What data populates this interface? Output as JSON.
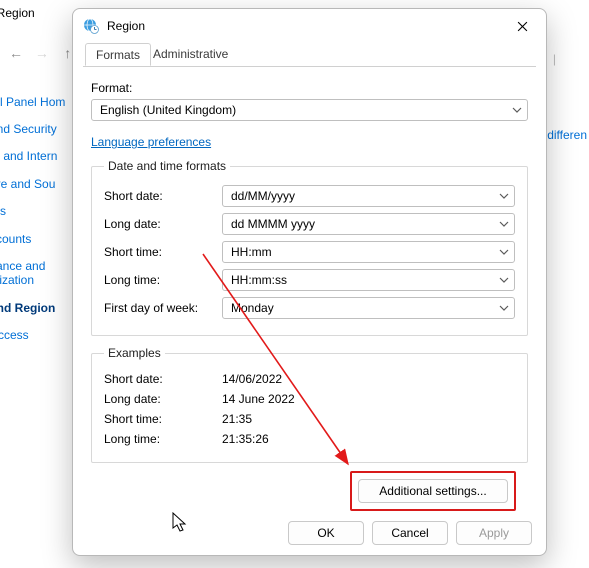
{
  "bg": {
    "breadcrumb_tail": "nd Region",
    "home_link": "l Panel Hom",
    "right_link": "differen",
    "sidebar": [
      "and Security",
      "rk and Intern",
      "are and Sou",
      "ms",
      "ccounts",
      "vance and\nalization",
      "and Region",
      "Access"
    ]
  },
  "dialog": {
    "title": "Region",
    "tabs": {
      "formats": "Formats",
      "administrative": "Administrative"
    },
    "format_label": "Format:",
    "format_value": "English (United Kingdom)",
    "lang_pref": "Language preferences",
    "group_datetime": "Date and time formats",
    "rows": {
      "short_date": {
        "label": "Short date:",
        "value": "dd/MM/yyyy"
      },
      "long_date": {
        "label": "Long date:",
        "value": "dd MMMM yyyy"
      },
      "short_time": {
        "label": "Short time:",
        "value": "HH:mm"
      },
      "long_time": {
        "label": "Long time:",
        "value": "HH:mm:ss"
      },
      "first_day": {
        "label": "First day of week:",
        "value": "Monday"
      }
    },
    "group_examples": "Examples",
    "examples": {
      "short_date": {
        "label": "Short date:",
        "value": "14/06/2022"
      },
      "long_date": {
        "label": "Long date:",
        "value": "14 June 2022"
      },
      "short_time": {
        "label": "Short time:",
        "value": "21:35"
      },
      "long_time": {
        "label": "Long time:",
        "value": "21:35:26"
      }
    },
    "additional": "Additional settings...",
    "ok": "OK",
    "cancel": "Cancel",
    "apply": "Apply"
  }
}
